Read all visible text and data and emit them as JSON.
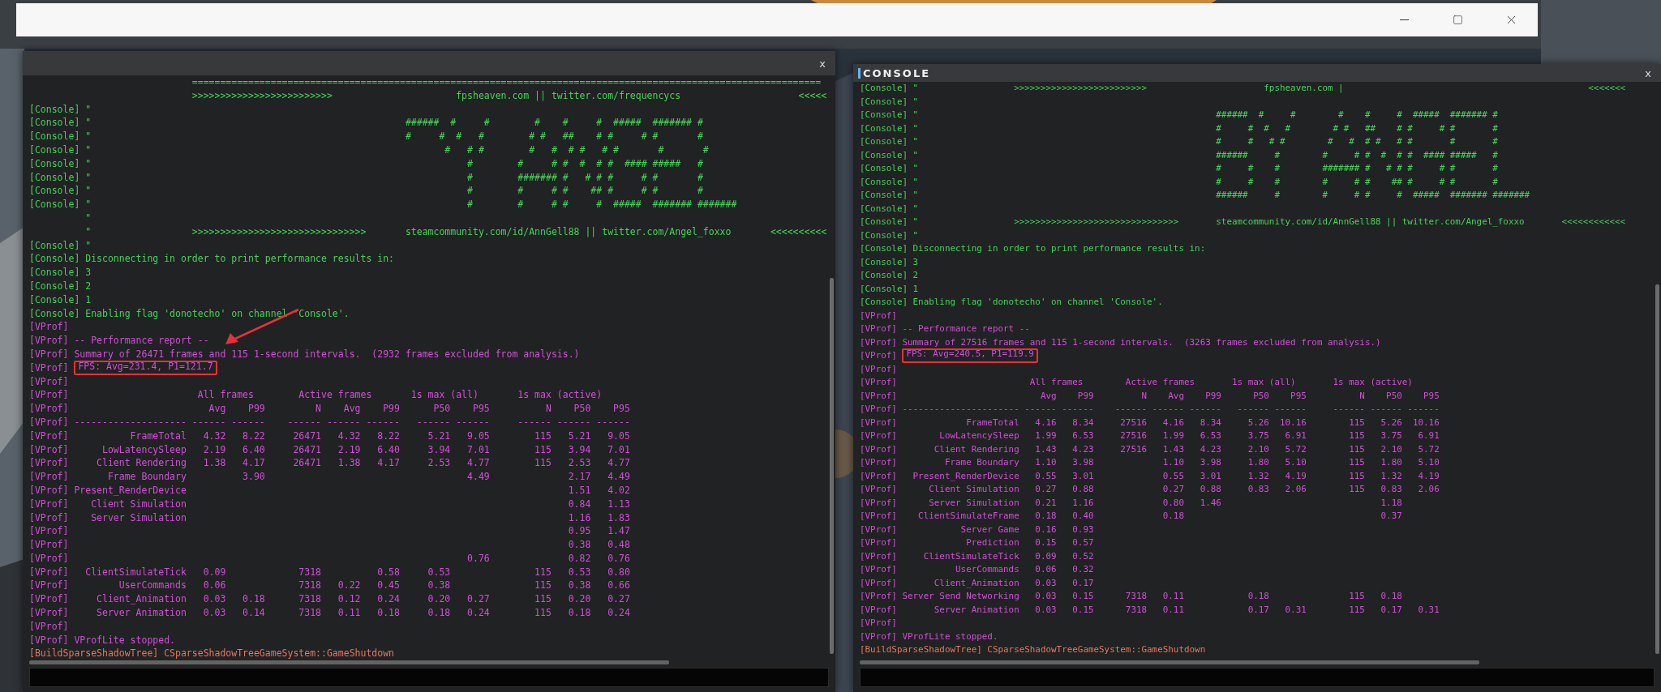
{
  "consoles": [
    {
      "close": "x",
      "before": [
        {
          "kind": "console",
          "text": "                             ================================================================================================================"
        },
        {
          "kind": "console",
          "text": "                             >>>>>>>>>>>>>>>>>>>>>>>>>                      fpsheaven.com || twitter.com/frequencycs                     <<<<<"
        },
        {
          "kind": "console",
          "text": "[Console] \""
        },
        {
          "kind": "console",
          "text": "[Console] \"                                                        ######  #     #        #    #     #  #####  ####### #"
        },
        {
          "kind": "console",
          "text": "[Console] \"                                                        #     #  #   #        # #   ##    # #     # #       #"
        },
        {
          "kind": "console",
          "text": "[Console] \"                                                               #   # #        #   #  # #   # #       #       #"
        },
        {
          "kind": "console",
          "text": "[Console] \"                                                                   #        #     # #  #  # #  #### #####   #"
        },
        {
          "kind": "console",
          "text": "[Console] \"                                                                   #        ####### #   # # #     # #       #"
        },
        {
          "kind": "console",
          "text": "[Console] \"                                                                   #        #     # #    ## #     # #       #"
        },
        {
          "kind": "console",
          "text": "[Console] \"                                                                   #        #     # #     #  #####  ####### #######"
        },
        {
          "kind": "console",
          "text": "          \""
        },
        {
          "kind": "console",
          "text": "          \"                  >>>>>>>>>>>>>>>>>>>>>>>>>>>>>>>       steamcommunity.com/id/AnnGell88 || twitter.com/Angel_foxxo       <<<<<<<<<<"
        },
        {
          "kind": "console",
          "text": "[Console] \""
        },
        {
          "kind": "console",
          "text": "[Console] Disconnecting in order to print performance results in:"
        },
        {
          "kind": "console",
          "text": "[Console] 3"
        },
        {
          "kind": "console",
          "text": "[Console] 2"
        },
        {
          "kind": "console",
          "text": "[Console] 1"
        },
        {
          "kind": "console",
          "text": "[Console] Enabling flag 'donotecho' on channel 'Console'."
        },
        {
          "kind": "vprof",
          "text": "[VProf]"
        },
        {
          "kind": "vprof",
          "text": "[VProf] -- Performance report --"
        },
        {
          "kind": "vprof",
          "text": "[VProf] Summary of 26471 frames and 115 1-second intervals.  (2932 frames excluded from analysis.)"
        },
        {
          "kind": "vprof",
          "text": "[VProf]",
          "highlight": "FPS: Avg=231.4, P1=121.7"
        },
        {
          "kind": "vprof",
          "text": "[VProf]"
        }
      ],
      "table": {
        "group_row": {
          "prefix": "[VProf]",
          "groups": [
            "All frames",
            "Active frames",
            "1s max (all)",
            "1s max (active)"
          ]
        },
        "column_row": {
          "prefix": "[VProf]",
          "columns": [
            "Avg",
            "P99",
            "N",
            "Avg",
            "P99",
            "P50",
            "P95",
            "N",
            "P50",
            "P95"
          ]
        },
        "rule_row": {
          "prefix": "[VProf]",
          "dashes": [
            "--------------------",
            "------",
            "------",
            "------",
            "------",
            "------",
            "------",
            "------",
            "------",
            "------",
            "------"
          ]
        },
        "rows": [
          {
            "prefix": "[VProf]",
            "name": "FrameTotal",
            "values": {
              "all_avg": "4.32",
              "all_p99": "8.22",
              "active_n": "26471",
              "active_avg": "4.32",
              "active_p99": "8.22",
              "max_all_p50": "5.21",
              "max_all_p95": "9.05",
              "max_active_n": "115",
              "max_active_p50": "5.21",
              "max_active_p95": "9.05"
            }
          },
          {
            "prefix": "[VProf]",
            "name": "LowLatencySleep",
            "values": {
              "all_avg": "2.19",
              "all_p99": "6.40",
              "active_n": "26471",
              "active_avg": "2.19",
              "active_p99": "6.40",
              "max_all_p50": "3.94",
              "max_all_p95": "7.01",
              "max_active_n": "115",
              "max_active_p50": "3.94",
              "max_active_p95": "7.01"
            }
          },
          {
            "prefix": "[VProf]",
            "name": "Client Rendering",
            "values": {
              "all_avg": "1.38",
              "all_p99": "4.17",
              "active_n": "26471",
              "active_avg": "1.38",
              "active_p99": "4.17",
              "max_all_p50": "2.53",
              "max_all_p95": "4.77",
              "max_active_n": "115",
              "max_active_p50": "2.53",
              "max_active_p95": "4.77"
            }
          },
          {
            "prefix": "[VProf]",
            "name": "Frame Boundary",
            "values": {
              "all_p99": "3.90",
              "max_all_p95": "4.49",
              "max_active_p50": "2.17",
              "max_active_p95": "4.49"
            }
          },
          {
            "prefix": "[VProf]",
            "name": "Present_RenderDevice",
            "values": {
              "max_active_p50": "1.51",
              "max_active_p95": "4.02"
            }
          },
          {
            "prefix": "[VProf]",
            "name": "Client Simulation",
            "values": {
              "max_active_p50": "0.84",
              "max_active_p95": "1.13"
            }
          },
          {
            "prefix": "[VProf]",
            "name": "Server Simulation",
            "values": {
              "max_active_p50": "1.16",
              "max_active_p95": "1.83"
            }
          },
          {
            "prefix": "[VProf]",
            "values": {
              "max_active_p50": "0.95",
              "max_active_p95": "1.47"
            }
          },
          {
            "prefix": "[VProf]",
            "values": {
              "max_active_p50": "0.38",
              "max_active_p95": "0.48"
            }
          },
          {
            "prefix": "[VProf]",
            "values": {
              "max_all_p95": "0.76",
              "max_active_p50": "0.82",
              "max_active_p95": "0.76"
            }
          },
          {
            "prefix": "[VProf]",
            "name": "ClientSimulateTick",
            "values": {
              "all_avg": "0.09",
              "active_n": "7318",
              "active_p99": "0.58",
              "max_all_p50": "0.53",
              "max_active_n": "115",
              "max_active_p50": "0.53",
              "max_active_p95": "0.80"
            }
          },
          {
            "prefix": "[VProf]",
            "name": "UserCommands",
            "values": {
              "all_avg": "0.06",
              "active_n": "7318",
              "active_avg": "0.22",
              "active_p99": "0.45",
              "max_all_p50": "0.38",
              "max_active_n": "115",
              "max_active_p50": "0.38",
              "max_active_p95": "0.66"
            }
          },
          {
            "prefix": "[VProf]",
            "name": "Client_Animation",
            "values": {
              "all_avg": "0.03",
              "all_p99": "0.18",
              "active_n": "7318",
              "active_avg": "0.12",
              "active_p99": "0.24",
              "max_all_p50": "0.20",
              "max_all_p95": "0.27",
              "max_active_n": "115",
              "max_active_p50": "0.20",
              "max_active_p95": "0.27"
            }
          },
          {
            "prefix": "[VProf]",
            "name": "Server Animation",
            "values": {
              "all_avg": "0.03",
              "all_p99": "0.14",
              "active_n": "7318",
              "active_avg": "0.11",
              "active_p99": "0.18",
              "max_all_p50": "0.18",
              "max_all_p95": "0.24",
              "max_active_n": "115",
              "max_active_p50": "0.18",
              "max_active_p95": "0.24"
            }
          }
        ]
      },
      "after": [
        {
          "kind": "vprof",
          "text": "[VProf]"
        },
        {
          "kind": "vprof",
          "text": "[VProf] VProfLite stopped."
        },
        {
          "kind": "build",
          "text": "[BuildSparseShadowTree] CSparseShadowTreeGameSystem::GameShutdown"
        }
      ]
    },
    {
      "title": "CONSOLE",
      "close": "x",
      "before": [
        {
          "kind": "console",
          "text": "[Console] \"                  >>>>>>>>>>>>>>>>>>>>>>>>>                      fpsheaven.com |                                              <<<<<<<"
        },
        {
          "kind": "console",
          "text": "[Console] \""
        },
        {
          "kind": "console",
          "text": "[Console] \"                                                        ######  #     #        #    #     #  #####  ####### #"
        },
        {
          "kind": "console",
          "text": "[Console] \"                                                        #     #  #   #        # #   ##    # #     # #       #"
        },
        {
          "kind": "console",
          "text": "[Console] \"                                                        #     #   # #        #   #  # #   # #       #       #"
        },
        {
          "kind": "console",
          "text": "[Console] \"                                                        ######     #        #     # #  #  # #  #### #####   #"
        },
        {
          "kind": "console",
          "text": "[Console] \"                                                        #     #    #        ####### #   # # #     # #       #"
        },
        {
          "kind": "console",
          "text": "[Console] \"                                                        #     #    #        #     # #    ## #     # #       #"
        },
        {
          "kind": "console",
          "text": "[Console] \"                                                        ######     #        #     # #     #  #####  ####### #######"
        },
        {
          "kind": "console",
          "text": "[Console] \""
        },
        {
          "kind": "console",
          "text": "[Console] \"                  >>>>>>>>>>>>>>>>>>>>>>>>>>>>>>>       steamcommunity.com/id/AnnGell88 || twitter.com/Angel_foxxo       <<<<<<<<<<<<"
        },
        {
          "kind": "console",
          "text": "[Console] \""
        },
        {
          "kind": "console",
          "text": "[Console] Disconnecting in order to print performance results in:"
        },
        {
          "kind": "console",
          "text": "[Console] 3"
        },
        {
          "kind": "console",
          "text": "[Console] 2"
        },
        {
          "kind": "console",
          "text": "[Console] 1"
        },
        {
          "kind": "console",
          "text": "[Console] Enabling flag 'donotecho' on channel 'Console'."
        },
        {
          "kind": "vprof",
          "text": "[VProf]"
        },
        {
          "kind": "vprof",
          "text": "[VProf] -- Performance report --"
        },
        {
          "kind": "vprof",
          "text": "[VProf] Summary of 27516 frames and 115 1-second intervals.  (3263 frames excluded from analysis.)"
        },
        {
          "kind": "vprof",
          "text": "[VProf]",
          "highlight": "FPS: Avg=240.5, P1=119.9"
        },
        {
          "kind": "vprof",
          "text": "[VProf]"
        }
      ],
      "table": {
        "group_row": {
          "prefix": "[VProf]",
          "groups": [
            "All frames",
            "Active frames",
            "1s max (all)",
            "1s max (active)"
          ]
        },
        "column_row": {
          "prefix": "[VProf]",
          "columns": [
            "Avg",
            "P99",
            "N",
            "Avg",
            "P99",
            "P50",
            "P95",
            "N",
            "P50",
            "P95"
          ]
        },
        "rule_row": {
          "prefix": "[VProf]",
          "dashes": [
            "----------------------",
            "------",
            "------",
            "------",
            "------",
            "------",
            "------",
            "------",
            "------",
            "------",
            "------"
          ]
        },
        "rows": [
          {
            "prefix": "[VProf]",
            "name": "FrameTotal",
            "values": {
              "all_avg": "4.16",
              "all_p99": "8.34",
              "active_n": "27516",
              "active_avg": "4.16",
              "active_p99": "8.34",
              "max_all_p50": "5.26",
              "max_all_p95": "10.16",
              "max_active_n": "115",
              "max_active_p50": "5.26",
              "max_active_p95": "10.16"
            }
          },
          {
            "prefix": "[VProf]",
            "name": "LowLatencySleep",
            "values": {
              "all_avg": "1.99",
              "all_p99": "6.53",
              "active_n": "27516",
              "active_avg": "1.99",
              "active_p99": "6.53",
              "max_all_p50": "3.75",
              "max_all_p95": "6.91",
              "max_active_n": "115",
              "max_active_p50": "3.75",
              "max_active_p95": "6.91"
            }
          },
          {
            "prefix": "[VProf]",
            "name": "Client Rendering",
            "values": {
              "all_avg": "1.43",
              "all_p99": "4.23",
              "active_n": "27516",
              "active_avg": "1.43",
              "active_p99": "4.23",
              "max_all_p50": "2.10",
              "max_all_p95": "5.72",
              "max_active_n": "115",
              "max_active_p50": "2.10",
              "max_active_p95": "5.72"
            }
          },
          {
            "prefix": "[VProf]",
            "name": "Frame Boundary",
            "values": {
              "all_avg": "1.10",
              "all_p99": "3.98",
              "active_avg": "1.10",
              "active_p99": "3.98",
              "max_all_p50": "1.80",
              "max_all_p95": "5.10",
              "max_active_n": "115",
              "max_active_p50": "1.80",
              "max_active_p95": "5.10"
            }
          },
          {
            "prefix": "[VProf]",
            "name": "Present_RenderDevice",
            "values": {
              "all_avg": "0.55",
              "all_p99": "3.01",
              "active_avg": "0.55",
              "active_p99": "3.01",
              "max_all_p50": "1.32",
              "max_all_p95": "4.19",
              "max_active_n": "115",
              "max_active_p50": "1.32",
              "max_active_p95": "4.19"
            }
          },
          {
            "prefix": "[VProf]",
            "name": "Client Simulation",
            "values": {
              "all_avg": "0.27",
              "all_p99": "0.88",
              "active_avg": "0.27",
              "active_p99": "0.88",
              "max_all_p50": "0.83",
              "max_all_p95": "2.06",
              "max_active_n": "115",
              "max_active_p50": "0.83",
              "max_active_p95": "2.06"
            }
          },
          {
            "prefix": "[VProf]",
            "name": "Server Simulation",
            "values": {
              "all_avg": "0.21",
              "all_p99": "1.16",
              "active_avg": "0.80",
              "active_p99": "1.46",
              "max_active_p50": "1.18"
            }
          },
          {
            "prefix": "[VProf]",
            "name": "ClientSimulateFrame",
            "values": {
              "all_avg": "0.18",
              "all_p99": "0.40",
              "active_avg": "0.18",
              "max_active_p50": "0.37"
            }
          },
          {
            "prefix": "[VProf]",
            "name": "Server Game",
            "values": {
              "all_avg": "0.16",
              "all_p99": "0.93"
            }
          },
          {
            "prefix": "[VProf]",
            "name": "Prediction",
            "values": {
              "all_avg": "0.15",
              "all_p99": "0.57"
            }
          },
          {
            "prefix": "[VProf]",
            "name": "ClientSimulateTick",
            "values": {
              "all_avg": "0.09",
              "all_p99": "0.52"
            }
          },
          {
            "prefix": "[VProf]",
            "name": "UserCommands",
            "values": {
              "all_avg": "0.06",
              "all_p99": "0.32"
            }
          },
          {
            "prefix": "[VProf]",
            "name": "Client_Animation",
            "values": {
              "all_avg": "0.03",
              "all_p99": "0.17"
            }
          },
          {
            "prefix": "[VProf]",
            "name": "Server Send Networking",
            "values": {
              "all_avg": "0.03",
              "all_p99": "0.15",
              "active_n": "7318",
              "active_avg": "0.11",
              "max_all_p50": "0.18",
              "max_active_n": "115",
              "max_active_p50": "0.18"
            }
          },
          {
            "prefix": "[VProf]",
            "name": "Server Animation",
            "values": {
              "all_avg": "0.03",
              "all_p99": "0.15",
              "active_n": "7318",
              "active_avg": "0.11",
              "max_all_p50": "0.17",
              "max_all_p95": "0.31",
              "max_active_n": "115",
              "max_active_p50": "0.17",
              "max_active_p95": "0.31"
            }
          }
        ]
      },
      "after": [
        {
          "kind": "vprof",
          "text": "[VProf]"
        },
        {
          "kind": "vprof",
          "text": "[VProf] VProfLite stopped."
        },
        {
          "kind": "build",
          "text": "[BuildSparseShadowTree] CSparseShadowTreeGameSystem::GameShutdown"
        }
      ]
    }
  ]
}
